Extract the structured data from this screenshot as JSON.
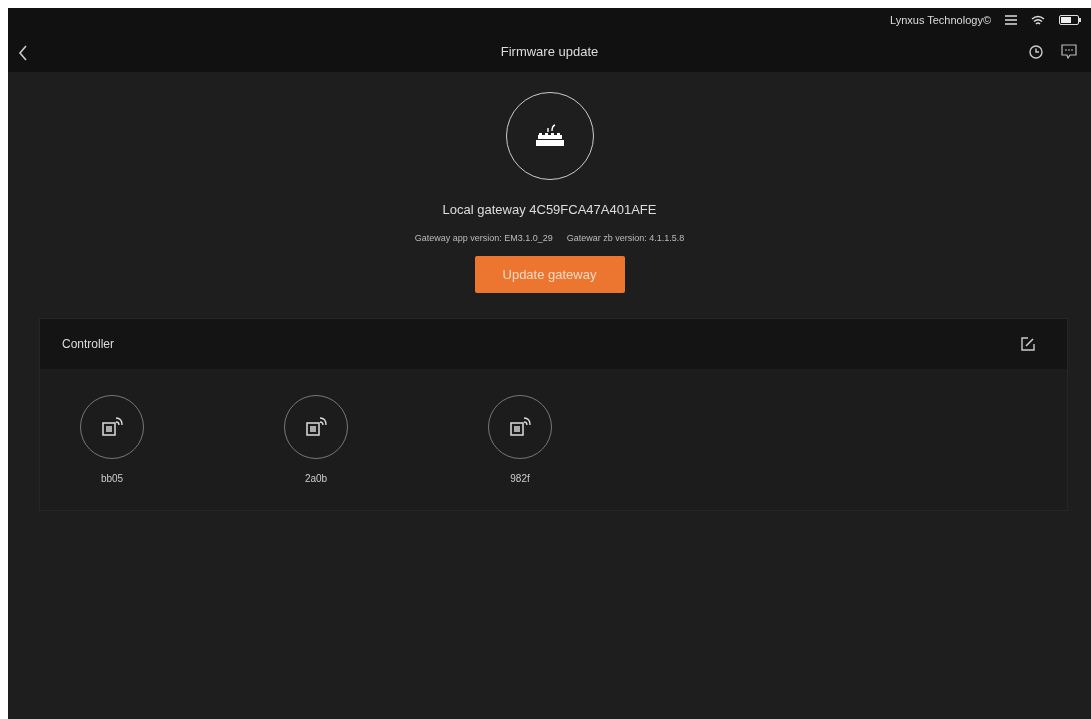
{
  "status_bar": {
    "carrier": "Lynxus Technology©"
  },
  "header": {
    "title": "Firmware update"
  },
  "gateway": {
    "name": "Local gateway 4C59FCA47A401AFE",
    "app_version": "Gateway app version: EM3.1.0_29",
    "zb_version": "Gatewar zb version: 4.1.1.5.8",
    "button": "Update gateway"
  },
  "controller": {
    "title": "Controller",
    "devices": [
      {
        "name": "bb05"
      },
      {
        "name": "2a0b"
      },
      {
        "name": "982f"
      }
    ]
  }
}
